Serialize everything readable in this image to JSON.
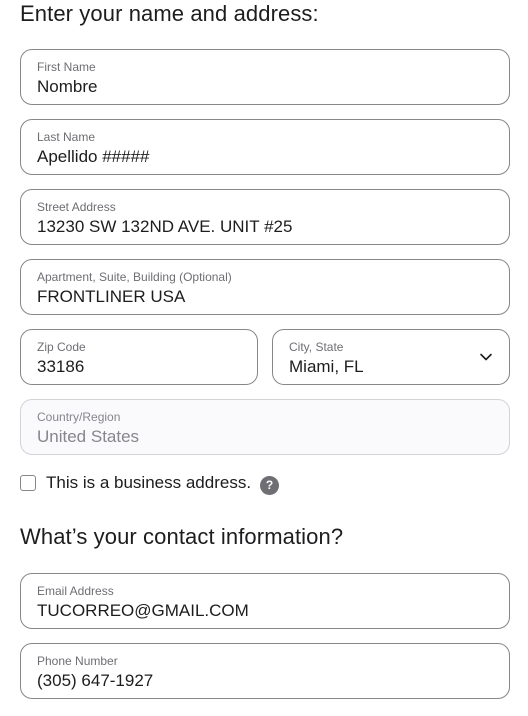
{
  "address_section": {
    "heading": "Enter your name and address:",
    "first_name": {
      "label": "First Name",
      "value": "Nombre"
    },
    "last_name": {
      "label": "Last Name",
      "value": "Apellido #####"
    },
    "street": {
      "label": "Street Address",
      "value": "13230 SW 132ND AVE. UNIT #25"
    },
    "apartment": {
      "label": "Apartment, Suite, Building (Optional)",
      "value": "FRONTLINER USA"
    },
    "zip": {
      "label": "Zip Code",
      "value": "33186"
    },
    "city_state": {
      "label": "City, State",
      "value": "Miami, FL",
      "icon": "chevron-down-icon"
    },
    "country": {
      "label": "Country/Region",
      "value": "United States"
    },
    "business_checkbox": {
      "label": "This is a business address.",
      "checked": false
    },
    "help_icon": {
      "glyph": "?",
      "icon": "help-icon"
    }
  },
  "contact_section": {
    "heading": "What’s your contact information?",
    "email": {
      "label": "Email Address",
      "value": "TUCORREO@GMAIL.COM"
    },
    "phone": {
      "label": "Phone Number",
      "value": "(305) 647-1927"
    }
  },
  "colors": {
    "text": "#1d1d1f",
    "label": "#6e6e73",
    "border": "#86868b",
    "disabled_border": "#d2d2d7",
    "help_icon_bg": "#6e6e73"
  }
}
